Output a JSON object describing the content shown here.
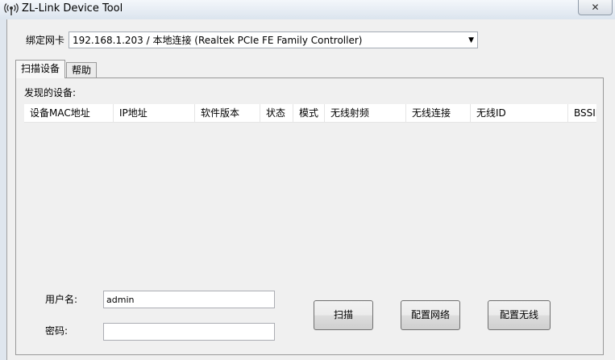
{
  "window": {
    "title": "ZL-Link Device Tool",
    "close_glyph": "✕"
  },
  "nic": {
    "label": "绑定网卡",
    "selected": "192.168.1.203 / 本地连接 (Realtek PCIe FE Family Controller)"
  },
  "tabs": [
    {
      "label": "扫描设备",
      "active": true
    },
    {
      "label": "帮助",
      "active": false
    }
  ],
  "scan": {
    "found_label": "发现的设备:",
    "columns": [
      "设备MAC地址",
      "IP地址",
      "软件版本",
      "状态",
      "模式",
      "无线射频",
      "无线连接",
      "无线ID",
      "BSSID"
    ],
    "rows": []
  },
  "form": {
    "username_label": "用户名:",
    "username_value": "admin",
    "password_label": "密码:",
    "password_value": ""
  },
  "buttons": {
    "scan": "扫描",
    "config_network": "配置网络",
    "config_wireless": "配置无线"
  },
  "icons": {
    "app": "antenna-icon",
    "dropdown": "dropdown-arrow-icon",
    "close": "close-icon"
  }
}
